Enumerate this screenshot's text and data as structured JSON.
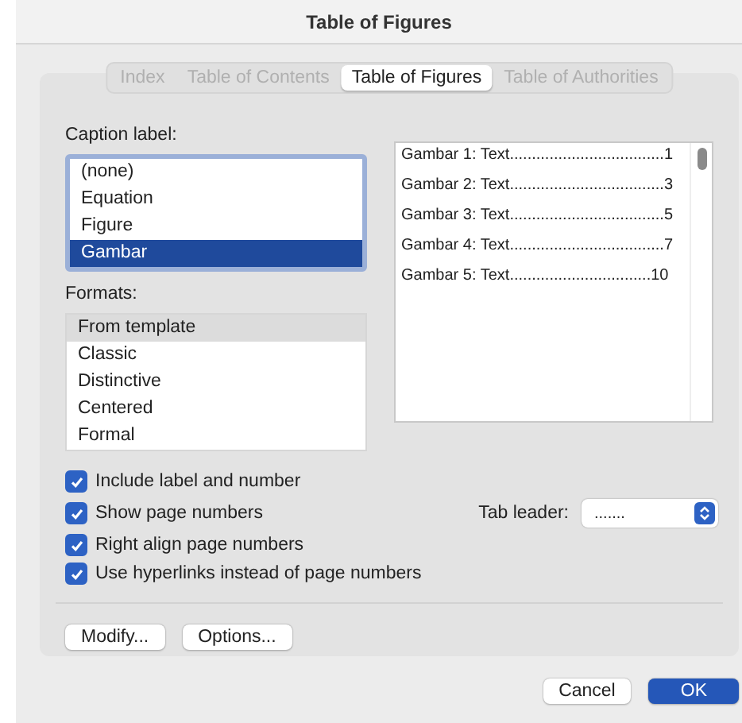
{
  "window": {
    "title": "Table of Figures"
  },
  "tabs": [
    {
      "label": "Index",
      "selected": false,
      "disabled": true
    },
    {
      "label": "Table of Contents",
      "selected": false,
      "disabled": true
    },
    {
      "label": "Table of Figures",
      "selected": true,
      "disabled": false
    },
    {
      "label": "Table of Authorities",
      "selected": false,
      "disabled": true
    }
  ],
  "caption_label": {
    "label": "Caption label:",
    "items": [
      {
        "label": "(none)",
        "selected": false
      },
      {
        "label": "Equation",
        "selected": false
      },
      {
        "label": "Figure",
        "selected": false
      },
      {
        "label": "Gambar",
        "selected": true
      }
    ]
  },
  "preview": [
    {
      "entry": "Gambar  1: Text",
      "leader": "...................................",
      "page": "1"
    },
    {
      "entry": "Gambar  2: Text",
      "leader": "...................................",
      "page": "3"
    },
    {
      "entry": "Gambar  3: Text",
      "leader": "...................................",
      "page": "5"
    },
    {
      "entry": "Gambar  4: Text",
      "leader": "...................................",
      "page": "7"
    },
    {
      "entry": "Gambar  5: Text",
      "leader": "................................",
      "page": "10"
    }
  ],
  "formats": {
    "label": "Formats:",
    "items": [
      {
        "label": "From template",
        "selected": true
      },
      {
        "label": "Classic",
        "selected": false
      },
      {
        "label": "Distinctive",
        "selected": false
      },
      {
        "label": "Centered",
        "selected": false
      },
      {
        "label": "Formal",
        "selected": false
      }
    ]
  },
  "options": [
    {
      "label": "Include label and number",
      "checked": true
    },
    {
      "label": "Show page numbers",
      "checked": true
    },
    {
      "label": "Right align page numbers",
      "checked": true
    },
    {
      "label": "Use hyperlinks instead of page numbers",
      "checked": true
    }
  ],
  "tab_leader": {
    "label": "Tab leader:",
    "value": "......."
  },
  "panel_buttons": [
    "Modify...",
    "Options..."
  ],
  "buttons": [
    {
      "label": "Cancel",
      "kind": "secondary"
    },
    {
      "label": "OK",
      "kind": "primary"
    }
  ]
}
